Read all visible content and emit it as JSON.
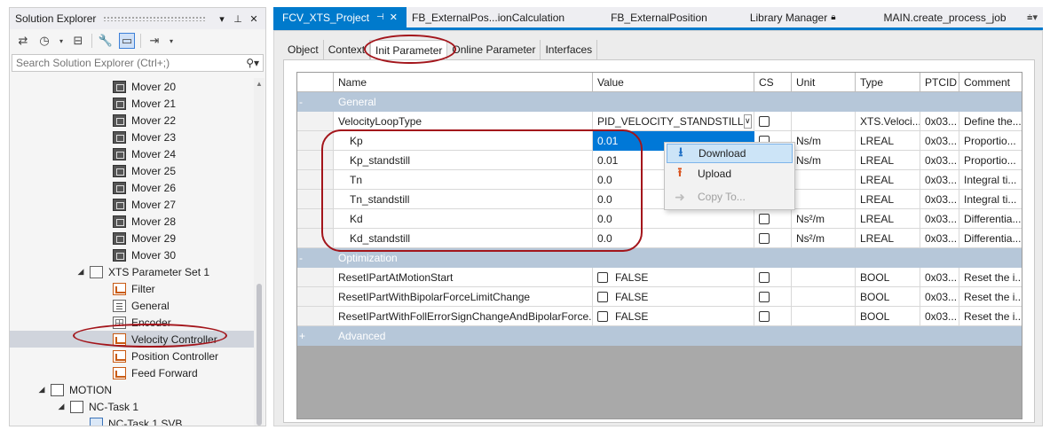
{
  "solution_explorer": {
    "title": "Solution Explorer",
    "title_buttons": [
      "▾",
      "⊥",
      "✕"
    ],
    "search_placeholder": "Search Solution Explorer (Ctrl+;)",
    "tree": [
      {
        "label": "Mover 20",
        "icon": "mover-icon",
        "level": 3
      },
      {
        "label": "Mover 21",
        "icon": "mover-icon",
        "level": 3
      },
      {
        "label": "Mover 22",
        "icon": "mover-icon",
        "level": 3
      },
      {
        "label": "Mover 23",
        "icon": "mover-icon",
        "level": 3
      },
      {
        "label": "Mover 24",
        "icon": "mover-icon",
        "level": 3
      },
      {
        "label": "Mover 25",
        "icon": "mover-icon",
        "level": 3
      },
      {
        "label": "Mover 26",
        "icon": "mover-icon",
        "level": 3
      },
      {
        "label": "Mover 27",
        "icon": "mover-icon",
        "level": 3
      },
      {
        "label": "Mover 28",
        "icon": "mover-icon",
        "level": 3
      },
      {
        "label": "Mover 29",
        "icon": "mover-icon",
        "level": 3
      },
      {
        "label": "Mover 30",
        "icon": "mover-icon",
        "level": 3
      },
      {
        "label": "XTS Parameter Set 1",
        "icon": "parameter-set-icon",
        "level": 2,
        "expander": "◢"
      },
      {
        "label": "Filter",
        "icon": "filter-icon",
        "level": 3
      },
      {
        "label": "General",
        "icon": "general-icon",
        "level": 3
      },
      {
        "label": "Encoder",
        "icon": "encoder-icon",
        "level": 3
      },
      {
        "label": "Velocity Controller",
        "icon": "velocity-controller-icon",
        "level": 3,
        "selected": true
      },
      {
        "label": "Position Controller",
        "icon": "position-controller-icon",
        "level": 3
      },
      {
        "label": "Feed Forward",
        "icon": "feed-forward-icon",
        "level": 3
      },
      {
        "label": "MOTION",
        "icon": "motion-icon",
        "level": 0,
        "expander": "◢"
      },
      {
        "label": "NC-Task 1",
        "icon": "nc-task-icon",
        "level": 1,
        "expander": "◢"
      },
      {
        "label": "NC-Task 1 SVB",
        "icon": "svb-icon",
        "level": 2
      }
    ]
  },
  "doc_tabs": [
    {
      "label": "FCV_XTS_Project",
      "active": true
    },
    {
      "label": "FB_ExternalPos...ionCalculation"
    },
    {
      "label": "FB_ExternalPosition"
    },
    {
      "label": "Library Manager",
      "lock": true
    },
    {
      "label": "MAIN.create_process_job"
    }
  ],
  "inner_tabs": [
    "Object",
    "Context",
    "Init Parameter",
    "Online Parameter",
    "Interfaces"
  ],
  "inner_active": "Init Parameter",
  "grid": {
    "columns": [
      "",
      "Name",
      "Value",
      "CS",
      "Unit",
      "Type",
      "PTCID",
      "Comment"
    ],
    "groups": {
      "general": {
        "sign": "-",
        "label": "General"
      },
      "optimization": {
        "sign": "-",
        "label": "Optimization"
      },
      "advanced": {
        "sign": "+",
        "label": "Advanced"
      }
    },
    "general_rows": [
      {
        "name": "VelocityLoopType",
        "value": "PID_VELOCITY_STANDSTILL",
        "dropdown": true,
        "unit": "",
        "type": "XTS.Veloci...",
        "ptcid": "0x03...",
        "comment": "Define the..."
      },
      {
        "name": "Kp",
        "value": "0.01",
        "selected": true,
        "unit": "Ns/m",
        "type": "LREAL",
        "ptcid": "0x03...",
        "comment": "Proportio..."
      },
      {
        "name": "Kp_standstill",
        "value": "0.01",
        "unit": "Ns/m",
        "type": "LREAL",
        "ptcid": "0x03...",
        "comment": "Proportio..."
      },
      {
        "name": "Tn",
        "value": "0.0",
        "unit": "",
        "type": "LREAL",
        "ptcid": "0x03...",
        "comment": "Integral ti..."
      },
      {
        "name": "Tn_standstill",
        "value": "0.0",
        "unit": "",
        "type": "LREAL",
        "ptcid": "0x03...",
        "comment": "Integral ti..."
      },
      {
        "name": "Kd",
        "value": "0.0",
        "unit": "Ns²/m",
        "type": "LREAL",
        "ptcid": "0x03...",
        "comment": "Differentia..."
      },
      {
        "name": "Kd_standstill",
        "value": "0.0",
        "unit": "Ns²/m",
        "type": "LREAL",
        "ptcid": "0x03...",
        "comment": "Differentia..."
      }
    ],
    "optimization_rows": [
      {
        "name": "ResetIPartAtMotionStart",
        "value": "FALSE",
        "unit": "",
        "type": "BOOL",
        "ptcid": "0x03...",
        "comment": "Reset the i..."
      },
      {
        "name": "ResetIPartWithBipolarForceLimitChange",
        "value": "FALSE",
        "unit": "",
        "type": "BOOL",
        "ptcid": "0x03...",
        "comment": "Reset the i..."
      },
      {
        "name": "ResetIPartWithFollErrorSignChangeAndBipolarForce...",
        "value": "FALSE",
        "unit": "",
        "type": "BOOL",
        "ptcid": "0x03...",
        "comment": "Reset the i..."
      }
    ]
  },
  "context_menu": [
    {
      "label": "Download",
      "icon": "download-icon",
      "highlighted": true
    },
    {
      "label": "Upload",
      "icon": "upload-icon"
    },
    {
      "label": "Copy To...",
      "icon": "copy-to-icon",
      "disabled": true
    }
  ],
  "colors": {
    "accent": "#007acc",
    "selection": "#0078d7",
    "group_header": "#b6c7d9",
    "annotation": "#a3151b"
  }
}
